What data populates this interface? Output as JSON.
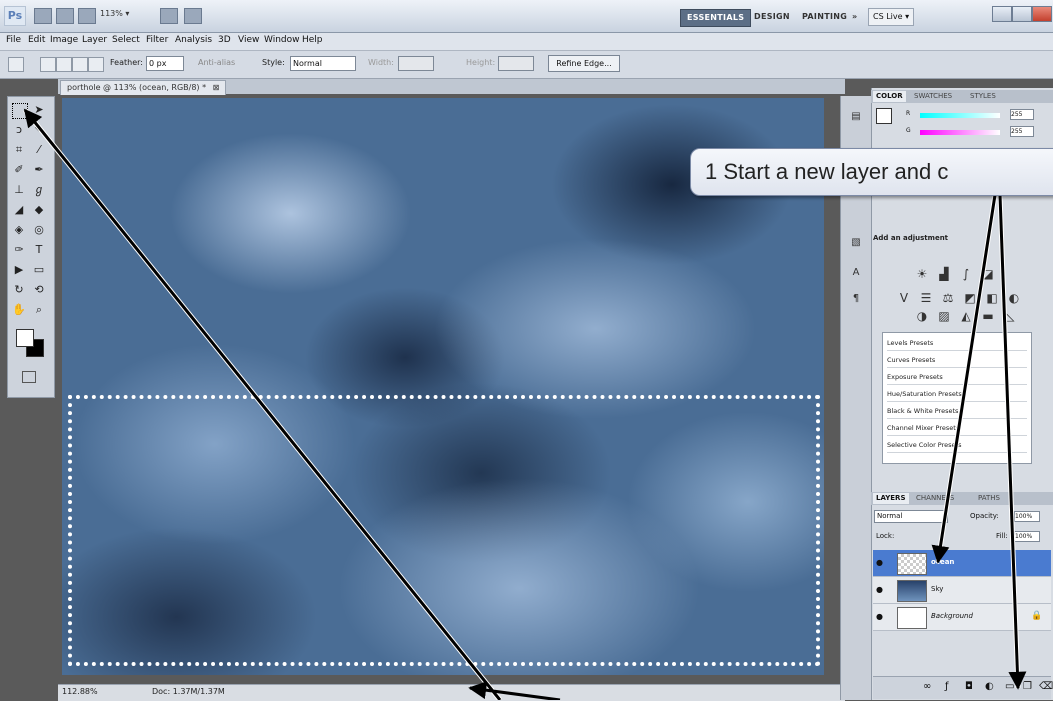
{
  "appbar": {
    "logo": "Ps",
    "zoom": "113% ▾",
    "workspaces": [
      "ESSENTIALS",
      "DESIGN",
      "PAINTING"
    ],
    "more": "»",
    "cslive": "CS Live ▾"
  },
  "menu": [
    "File",
    "Edit",
    "Image",
    "Layer",
    "Select",
    "Filter",
    "Analysis",
    "3D",
    "View",
    "Window",
    "Help"
  ],
  "options": {
    "feather_label": "Feather:",
    "feather_value": "0 px",
    "antialias_label": "Anti-alias",
    "style_label": "Style:",
    "style_value": "Normal",
    "width_label": "Width:",
    "height_label": "Height:",
    "refine_edge": "Refine Edge..."
  },
  "document": {
    "tab_title": "porthole @ 113% (ocean, RGB/8) *",
    "close": "⊠"
  },
  "status": {
    "zoom": "112.88%",
    "doc": "Doc: 1.37M/1.37M"
  },
  "color_panel": {
    "tabs": [
      "COLOR",
      "SWATCHES",
      "STYLES"
    ],
    "r_label": "R",
    "g_label": "G",
    "r_value": "255",
    "g_value": "255"
  },
  "adjustments": {
    "title": "Add an adjustment",
    "presets": [
      "Levels Presets",
      "Curves Presets",
      "Exposure Presets",
      "Hue/Saturation Presets",
      "Black & White Presets",
      "Channel Mixer Presets",
      "Selective Color Presets"
    ]
  },
  "layers_panel": {
    "tabs": [
      "LAYERS",
      "CHANNELS",
      "PATHS"
    ],
    "blend_mode": "Normal",
    "opacity_label": "Opacity:",
    "opacity_value": "100%",
    "lock_label": "Lock:",
    "fill_label": "Fill:",
    "fill_value": "100%",
    "layers": [
      {
        "name": "ocean",
        "selected": true
      },
      {
        "name": "Sky",
        "selected": false
      },
      {
        "name": "Background",
        "selected": false
      }
    ]
  },
  "callout": {
    "text": "1  Start a new layer and c"
  },
  "colors": {
    "accent": "#5c6e86",
    "selection": "#4a7bd0",
    "arrow": "#000000"
  }
}
